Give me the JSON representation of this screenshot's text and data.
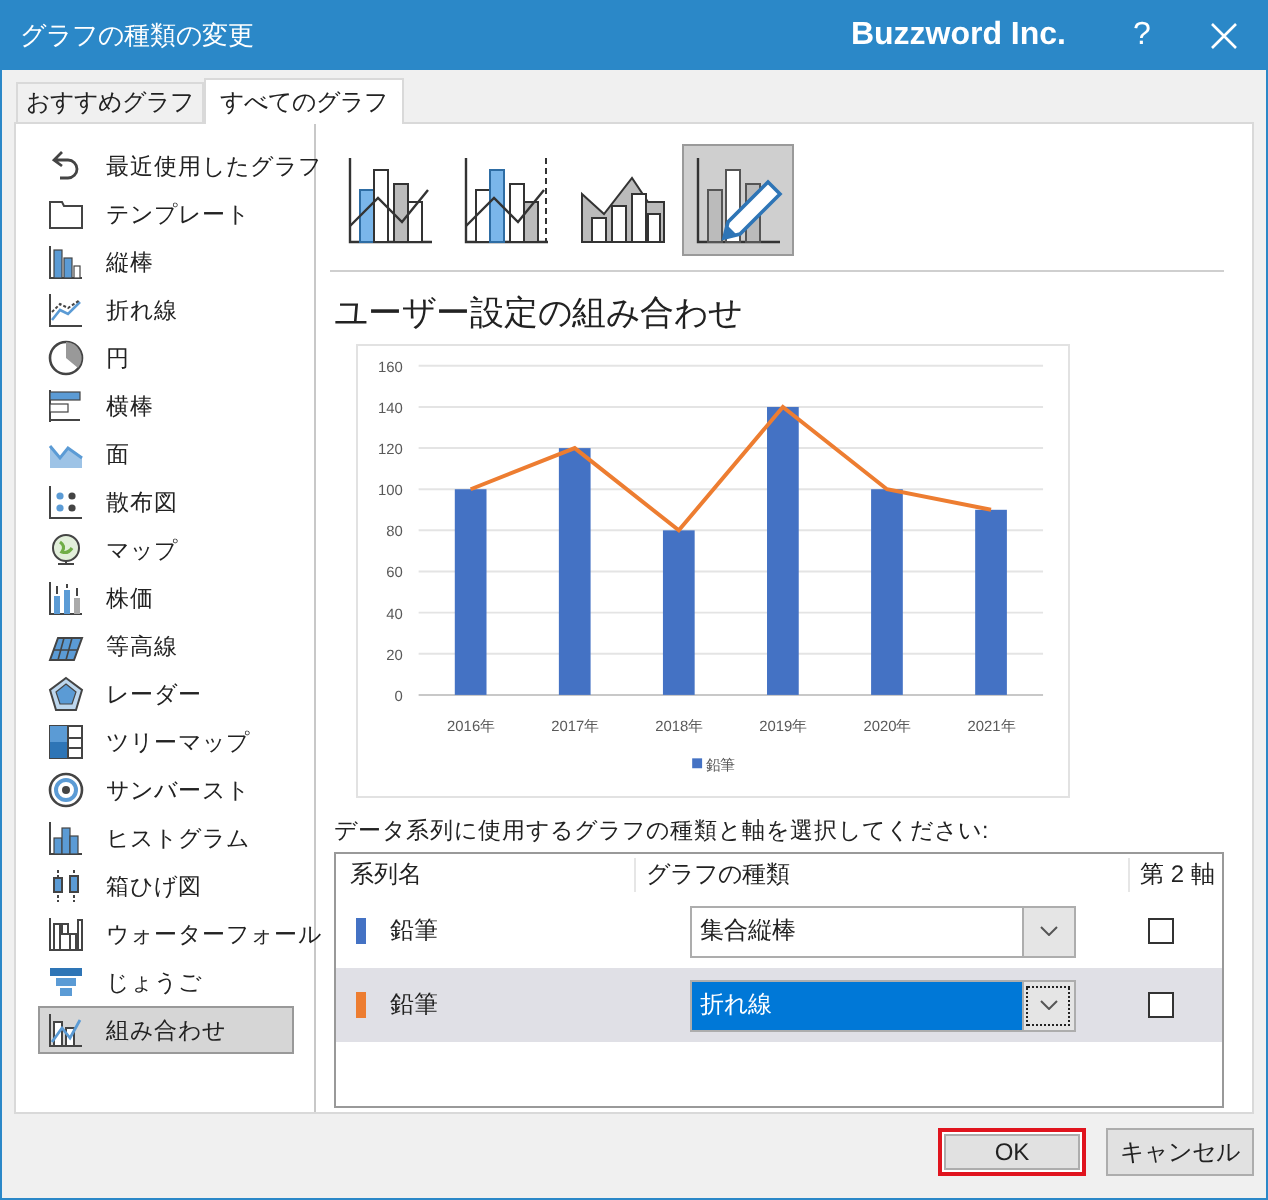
{
  "window": {
    "title": "グラフの種類の変更",
    "company": "Buzzword Inc.",
    "help": "?"
  },
  "tabs": [
    {
      "label": "おすすめグラフ",
      "selected": false
    },
    {
      "label": "すべてのグラフ",
      "selected": true
    }
  ],
  "chart_types": [
    {
      "label": "最近使用したグラフ",
      "selected": false
    },
    {
      "label": "テンプレート",
      "selected": false
    },
    {
      "label": "縦棒",
      "selected": false
    },
    {
      "label": "折れ線",
      "selected": false
    },
    {
      "label": "円",
      "selected": false
    },
    {
      "label": "横棒",
      "selected": false
    },
    {
      "label": "面",
      "selected": false
    },
    {
      "label": "散布図",
      "selected": false
    },
    {
      "label": "マップ",
      "selected": false
    },
    {
      "label": "株価",
      "selected": false
    },
    {
      "label": "等高線",
      "selected": false
    },
    {
      "label": "レーダー",
      "selected": false
    },
    {
      "label": "ツリーマップ",
      "selected": false
    },
    {
      "label": "サンバースト",
      "selected": false
    },
    {
      "label": "ヒストグラム",
      "selected": false
    },
    {
      "label": "箱ひげ図",
      "selected": false
    },
    {
      "label": "ウォーターフォール",
      "selected": false
    },
    {
      "label": "じょうご",
      "selected": false
    },
    {
      "label": "組み合わせ",
      "selected": true
    }
  ],
  "subtypes": [
    {
      "selected": false
    },
    {
      "selected": false
    },
    {
      "selected": false
    },
    {
      "selected": true
    }
  ],
  "preview": {
    "title": "ユーザー設定の組み合わせ",
    "chart_data": {
      "type": "bar",
      "categories": [
        "2016年",
        "2017年",
        "2018年",
        "2019年",
        "2020年",
        "2021年"
      ],
      "ylim": [
        0,
        160
      ],
      "grid": true,
      "yticks": [
        0,
        20,
        40,
        60,
        80,
        100,
        120,
        140,
        160
      ],
      "series": [
        {
          "name": "鉛筆",
          "color": "#4472c4",
          "type": "bar",
          "values": [
            100,
            120,
            80,
            140,
            100,
            90
          ]
        },
        {
          "color": "#ed7d31",
          "type": "line",
          "values": [
            100,
            120,
            80,
            140,
            100,
            90
          ]
        }
      ]
    }
  },
  "series_table": {
    "instruction": "データ系列に使用するグラフの種類と軸を選択してください:",
    "columns": [
      "系列名",
      "グラフの種類",
      "第 2 軸"
    ],
    "rows": [
      {
        "color": "#4472c4",
        "name": "鉛筆",
        "chart_type": "集合縦棒",
        "secondary_axis": false,
        "selected": false
      },
      {
        "color": "#ed7d31",
        "name": "鉛筆",
        "chart_type": "折れ線",
        "secondary_axis": false,
        "selected": true
      }
    ]
  },
  "buttons": [
    {
      "label": "OK",
      "highlighted": true
    },
    {
      "label": "キャンセル",
      "highlighted": false
    }
  ]
}
